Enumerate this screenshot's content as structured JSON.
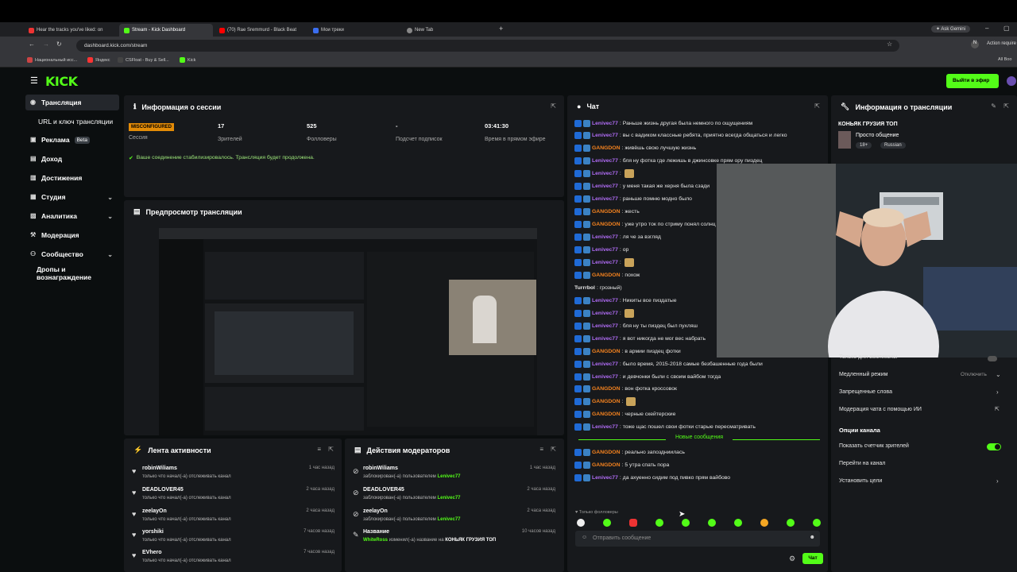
{
  "browser": {
    "tabs": [
      {
        "label": "Hear the tracks you've liked: on",
        "icon": "youtube-music-icon"
      },
      {
        "label": "Stream - Kick Dashboard",
        "icon": "kick-icon"
      },
      {
        "label": "(70) Rae Sremmurd - Black Beat",
        "icon": "youtube-icon"
      },
      {
        "label": "Мои треки",
        "icon": "music-icon"
      },
      {
        "label": "New Tab",
        "icon": "globe-icon"
      }
    ],
    "ask_gemini": "Ask Gemini",
    "url": "dashboard.kick.com/stream",
    "action_required": "Action require",
    "bookmarks": [
      "Национальный исс...",
      "Яндекс",
      "CSFloat - Buy & Sell...",
      "Kick"
    ],
    "all_bookmarks": "All Boo"
  },
  "header": {
    "logo": "KICK",
    "go_live": "Выйти в эфир"
  },
  "sidebar": {
    "items": [
      {
        "label": "Трансляция",
        "icon": "camera-icon"
      },
      {
        "label": "URL и ключ трансляции"
      },
      {
        "label": "Реклама",
        "badge": "Beta",
        "icon": "ad-icon"
      },
      {
        "label": "Доход",
        "icon": "money-icon"
      },
      {
        "label": "Достижения",
        "icon": "trophy-icon"
      },
      {
        "label": "Студия",
        "icon": "grid-icon"
      },
      {
        "label": "Аналитика",
        "icon": "chart-icon"
      },
      {
        "label": "Модерация",
        "icon": "hammer-icon"
      },
      {
        "label": "Сообщество",
        "icon": "community-icon"
      },
      {
        "label": "Дропы и вознаграждение"
      }
    ]
  },
  "session": {
    "title": "Информация о сессии",
    "status_badge": "MISCONFIGURED",
    "status_label": "Сессия",
    "viewers_value": "17",
    "viewers_label": "Зрителей",
    "followers_value": "525",
    "followers_label": "Фолловеры",
    "subs_value": "-",
    "subs_label": "Подсчет подписок",
    "time_value": "03:41:30",
    "time_label": "Время в прямом эфире",
    "notice": "Ваше соединение стабилизировалось. Трансляция будет продолжена."
  },
  "preview": {
    "title": "Предпросмотр трансляции"
  },
  "activity": {
    "title": "Лента активности",
    "items": [
      {
        "name": "robinWiliams",
        "desc": "только что начал(-а) отслеживать канал",
        "time": "1 час назад"
      },
      {
        "name": "DEADLOVER45",
        "desc": "только что начал(-а) отслеживать канал",
        "time": "2 часа назад"
      },
      {
        "name": "zeelayOn",
        "desc": "только что начал(-а) отслеживать канал",
        "time": "2 часа назад"
      },
      {
        "name": "yorshiki",
        "desc": "только что начал(-а) отслеживать канал",
        "time": "7 часов назад"
      },
      {
        "name": "EVhero",
        "desc": "только что начал(-а) отслеживать канал",
        "time": "7 часов назад"
      }
    ]
  },
  "mod_actions": {
    "title": "Действия модераторов",
    "items": [
      {
        "name": "robinWiliams",
        "desc": "заблокирован(-а) пользователем",
        "by": "Lenivec77",
        "time": "1 час назад"
      },
      {
        "name": "DEADLOVER45",
        "desc": "заблокирован(-а) пользователем",
        "by": "Lenivec77",
        "time": "2 часа назад"
      },
      {
        "name": "zeelayOn",
        "desc": "заблокирован(-а) пользователем",
        "by": "Lenivec77",
        "time": "2 часа назад"
      },
      {
        "name": "Название",
        "actor": "WhiteRoss",
        "desc": "изменил(-а) название на",
        "by": "КОНЬЯК ГРУЗИЯ ТОП",
        "time": "10 часов назад"
      }
    ]
  },
  "chat": {
    "title": "Чат",
    "messages": [
      {
        "user": "Lenivec77",
        "text": "Раньше жизнь другая была немного по ощущениям",
        "c": "l"
      },
      {
        "user": "Lenivec77",
        "text": "вы с вадиком классные ребята, приятно всегда общаться и легко",
        "c": "l"
      },
      {
        "user": "GANGDON",
        "text": "живёшь свою лучшую жизнь",
        "c": "g"
      },
      {
        "user": "Lenivec77",
        "text": "бля ну фотка где лежишь в джинсовке прям ору пиздец",
        "c": "l"
      },
      {
        "user": "Lenivec77",
        "text": "",
        "c": "l",
        "emote": true
      },
      {
        "user": "Lenivec77",
        "text": "у меня такая же херня была сзади",
        "c": "l"
      },
      {
        "user": "Lenivec77",
        "text": "раньше помню модно было",
        "c": "l"
      },
      {
        "user": "GANGDON",
        "text": "жесть",
        "c": "g"
      },
      {
        "user": "GANGDON",
        "text": "уже утро ток по стриму понял солнц",
        "c": "g"
      },
      {
        "user": "Lenivec77",
        "text": "ля че за взгляд",
        "c": "l"
      },
      {
        "user": "Lenivec77",
        "text": "ор",
        "c": "l"
      },
      {
        "user": "Lenivec77",
        "text": "",
        "c": "l",
        "emote": true
      },
      {
        "user": "GANGDON",
        "text": "похож",
        "c": "g"
      },
      {
        "user": "Turrrbol",
        "text": "грозный)",
        "c": "t"
      },
      {
        "user": "Lenivec77",
        "text": "Никиты все пиздатые",
        "c": "l"
      },
      {
        "user": "Lenivec77",
        "text": "",
        "c": "l",
        "emote": true
      },
      {
        "user": "Lenivec77",
        "text": "бля ну ты пиздец был пухляш",
        "c": "l"
      },
      {
        "user": "Lenivec77",
        "text": "я вот никогда не мог вес набрать",
        "c": "l"
      },
      {
        "user": "GANGDON",
        "text": "в армии пиздец фотки",
        "c": "g"
      },
      {
        "user": "Lenivec77",
        "text": "было время, 2015-2018 самые безбашенные года были",
        "c": "l"
      },
      {
        "user": "Lenivec77",
        "text": "и девчонки были с своим вайбом тогда",
        "c": "l"
      },
      {
        "user": "GANGDON",
        "text": "вон фотка кроссовок",
        "c": "g"
      },
      {
        "user": "GANGDON",
        "text": "",
        "c": "g",
        "emote": true
      },
      {
        "user": "GANGDON",
        "text": "черные скейтерские",
        "c": "g"
      },
      {
        "user": "Lenivec77",
        "text": "тоже щас пошел свои фотки старые пересматривать",
        "c": "l"
      }
    ],
    "new_messages": "Новые сообщения",
    "messages_after": [
      {
        "user": "GANGDON",
        "text": "реально запоздниилась",
        "c": "g"
      },
      {
        "user": "GANGDON",
        "text": "5 утра спать пора",
        "c": "g"
      },
      {
        "user": "Lenivec77",
        "text": "да ахуенно сидим под пивко прям вайбово",
        "c": "l"
      }
    ],
    "followers_only": "Только фолловеры",
    "input_placeholder": "Отправить сообщение",
    "send": "Чат"
  },
  "stream_info": {
    "title": "Информация о трансляции",
    "stream_title": "КОНЬЯК ГРУЗИЯ ТОП",
    "category": "Просто общение",
    "tags": [
      "18+",
      "Russian"
    ],
    "rows": [
      {
        "label": "Только для эмотиконы",
        "value": ""
      },
      {
        "label": "Медленный режим",
        "value": "Отключить"
      },
      {
        "label": "Запрещенные слова",
        "value": ""
      },
      {
        "label": "Модерация чата с помощью ИИ",
        "value": ""
      }
    ],
    "channel_options": "Опции канала",
    "show_viewers": "Показать счетчик зрителей",
    "go_channel": "Перейти на канал",
    "set_goals": "Установить цели"
  },
  "colors": {
    "accent": "#53fc18",
    "panel": "#17191c",
    "bg": "#0b0e0f"
  }
}
